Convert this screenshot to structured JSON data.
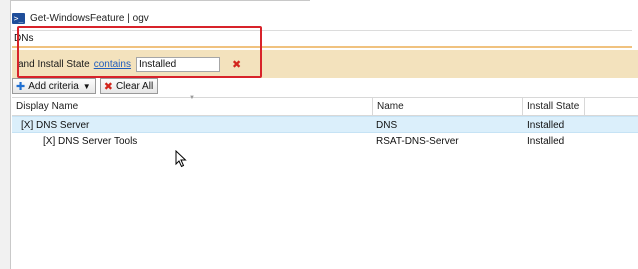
{
  "window": {
    "title": "Get-WindowsFeature | ogv",
    "icon": "powershell-icon",
    "icon_glyph": ">_"
  },
  "filter": {
    "value": "DNs"
  },
  "criteria": {
    "prefix": "and Install State",
    "operator": "contains",
    "value": "Installed",
    "remove_glyph": "✖"
  },
  "toolbar": {
    "add_criteria_label": "Add criteria",
    "clear_all_label": "Clear All"
  },
  "grid": {
    "columns": [
      {
        "label": "Display Name"
      },
      {
        "label": "Name"
      },
      {
        "label": "Install State"
      }
    ],
    "rows": [
      {
        "display_name": "[X] DNS Server",
        "name": "DNS",
        "install_state": "Installed",
        "selected": true
      },
      {
        "display_name": "[X] DNS Server Tools",
        "name": "RSAT-DNS-Server",
        "install_state": "Installed",
        "selected": false
      }
    ]
  },
  "colors": {
    "criteria_background": "#f3e2bd",
    "highlight_border": "#d8232a",
    "selected_row": "#dbeffb",
    "link": "#1f5cbd",
    "remove_red": "#d3261d"
  }
}
